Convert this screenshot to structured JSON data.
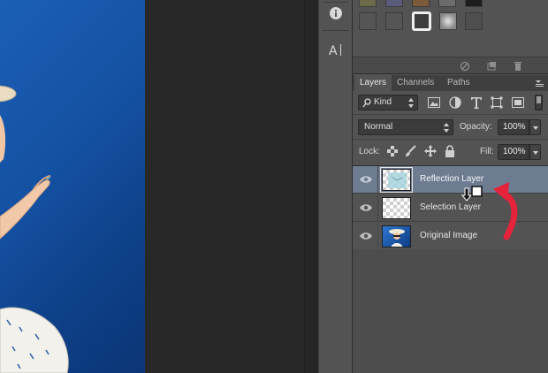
{
  "tabs": [
    {
      "label": "Layers",
      "active": true
    },
    {
      "label": "Channels",
      "active": false
    },
    {
      "label": "Paths",
      "active": false
    }
  ],
  "filter": {
    "kind_label": "Kind",
    "icons": [
      "image-filter-icon",
      "adjustment-filter-icon",
      "type-filter-icon",
      "shape-filter-icon",
      "smart-object-filter-icon"
    ]
  },
  "blend": {
    "mode": "Normal",
    "opacity_label": "Opacity:",
    "opacity_value": "100%"
  },
  "lock": {
    "label": "Lock:",
    "fill_label": "Fill:",
    "fill_value": "100%"
  },
  "layers": [
    {
      "name": "Reflection Layer",
      "visible": true,
      "selected": true,
      "thumb": "transparent-with-content"
    },
    {
      "name": "Selection Layer",
      "visible": true,
      "selected": false,
      "thumb": "transparent"
    },
    {
      "name": "Original Image",
      "visible": true,
      "selected": false,
      "thumb": "photo"
    }
  ],
  "tools": [
    "info-icon",
    "character-style-icon"
  ],
  "annotation": {
    "arrow_color": "#e5233a",
    "cursor": "drag-layer-cursor"
  },
  "colors": {
    "panel_bg": "#535353",
    "selected_row": "#6e7c92",
    "canvas_blue": "#1552a4"
  }
}
